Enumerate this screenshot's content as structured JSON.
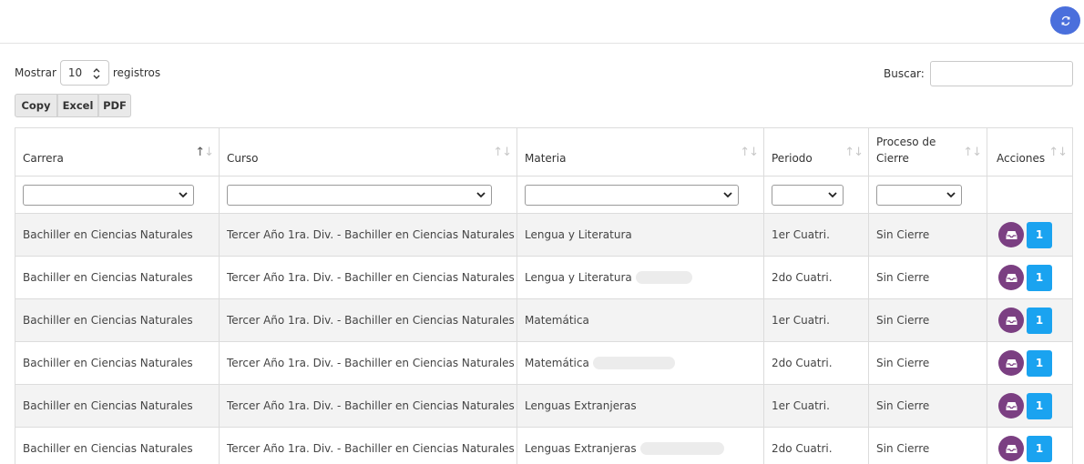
{
  "length_menu": {
    "prefix": "Mostrar",
    "value": "10",
    "suffix": "registros"
  },
  "search": {
    "label": "Buscar:",
    "value": ""
  },
  "export_buttons": [
    "Copy",
    "Excel",
    "PDF"
  ],
  "table": {
    "columns": [
      "Carrera",
      "Curso",
      "Materia",
      "Periodo",
      "Proceso de Cierre",
      "Acciones"
    ],
    "rows": [
      {
        "carrera": "Bachiller en Ciencias Naturales",
        "curso": "Tercer Año 1ra. Div. - Bachiller en Ciencias Naturales",
        "materia": "Lengua y Literatura",
        "periodo": "1er Cuatri.",
        "cierre": "Sin Cierre",
        "badge": "1"
      },
      {
        "carrera": "Bachiller en Ciencias Naturales",
        "curso": "Tercer Año 1ra. Div. - Bachiller en Ciencias Naturales",
        "materia": "Lengua y Literatura",
        "periodo": "2do Cuatri.",
        "cierre": "Sin Cierre",
        "badge": "1"
      },
      {
        "carrera": "Bachiller en Ciencias Naturales",
        "curso": "Tercer Año 1ra. Div. - Bachiller en Ciencias Naturales",
        "materia": "Matemática",
        "periodo": "1er Cuatri.",
        "cierre": "Sin Cierre",
        "badge": "1"
      },
      {
        "carrera": "Bachiller en Ciencias Naturales",
        "curso": "Tercer Año 1ra. Div. - Bachiller en Ciencias Naturales",
        "materia": "Matemática",
        "periodo": "2do Cuatri.",
        "cierre": "Sin Cierre",
        "badge": "1"
      },
      {
        "carrera": "Bachiller en Ciencias Naturales",
        "curso": "Tercer Año 1ra. Div. - Bachiller en Ciencias Naturales",
        "materia": "Lenguas Extranjeras",
        "periodo": "1er Cuatri.",
        "cierre": "Sin Cierre",
        "badge": "1"
      },
      {
        "carrera": "Bachiller en Ciencias Naturales",
        "curso": "Tercer Año 1ra. Div. - Bachiller en Ciencias Naturales",
        "materia": "Lenguas Extranjeras",
        "periodo": "2do Cuatri.",
        "cierre": "Sin Cierre",
        "badge": "1"
      }
    ]
  },
  "colors": {
    "refresh": "#4a6fdc",
    "inbox_button": "#7b3f82",
    "badge_button": "#1aa3f0"
  },
  "icons": {
    "refresh": "refresh-icon",
    "inbox": "inbox-icon",
    "sort": "sort-arrows-icon",
    "dropdown": "chevron-down-icon"
  }
}
